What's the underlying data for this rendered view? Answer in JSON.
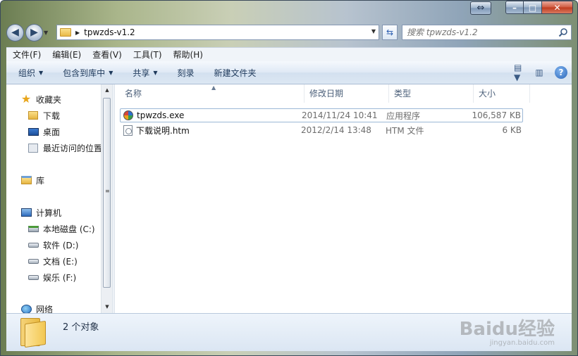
{
  "window": {
    "caption_extra": "⇔",
    "minimize": "–",
    "maximize": "□",
    "close": "✕"
  },
  "address": {
    "crumb": "tpwzds-v1.2",
    "search_placeholder": "搜索 tpwzds-v1.2"
  },
  "menu": [
    "文件(F)",
    "编辑(E)",
    "查看(V)",
    "工具(T)",
    "帮助(H)"
  ],
  "commands": {
    "organize": "组织",
    "include_in_library": "包含到库中",
    "share": "共享",
    "burn": "刻录",
    "new_folder": "新建文件夹"
  },
  "nav": {
    "favorites": "收藏夹",
    "downloads": "下载",
    "desktop": "桌面",
    "recent": "最近访问的位置",
    "libraries": "库",
    "computer": "计算机",
    "drive_c": "本地磁盘 (C:)",
    "drive_d": "软件 (D:)",
    "drive_e": "文档 (E:)",
    "drive_f": "娱乐 (F:)",
    "network": "网络"
  },
  "columns": {
    "name": "名称",
    "date": "修改日期",
    "type": "类型",
    "size": "大小"
  },
  "files": [
    {
      "name": "tpwzds.exe",
      "date": "2014/11/24 10:41",
      "type": "应用程序",
      "size": "106,587 KB"
    },
    {
      "name": "下载说明.htm",
      "date": "2012/2/14 13:48",
      "type": "HTM 文件",
      "size": "6 KB"
    }
  ],
  "status": {
    "count": "2 个对象"
  },
  "watermark": {
    "brand": "Baidu经验",
    "url": "jingyan.baidu.com"
  }
}
